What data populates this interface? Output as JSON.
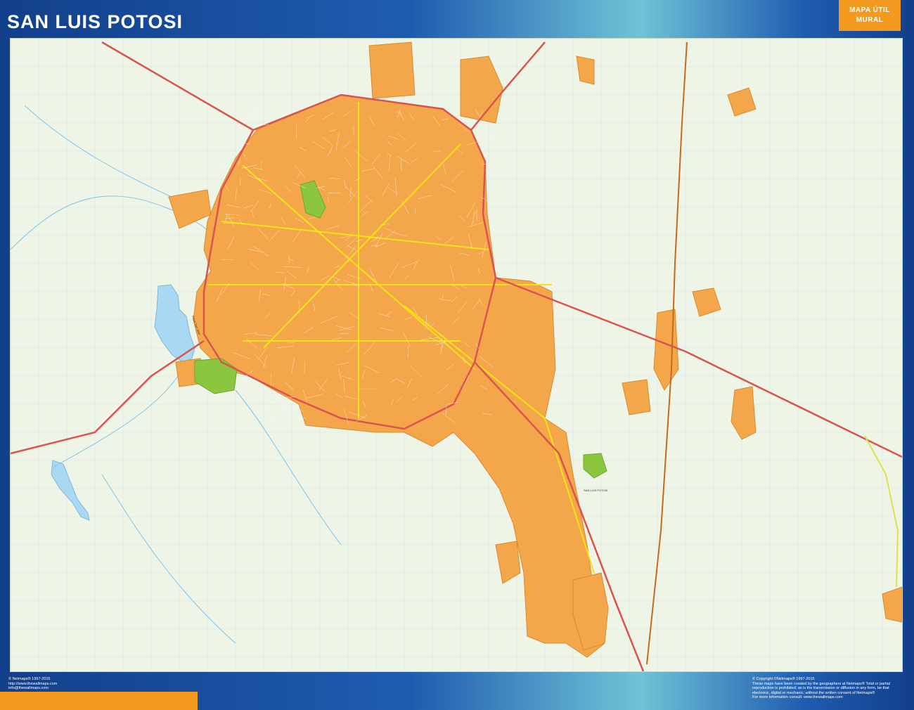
{
  "header": {
    "title": "SAN LUIS POTOSI",
    "badge_line1": "MAPA ÚTIL",
    "badge_line2": "MURAL"
  },
  "map": {
    "labels": {
      "city_center": "SAN LUIS POTOSI",
      "lake": "Presa San José"
    },
    "colors": {
      "land": "#eef5e7",
      "urban": "#f4a74a",
      "park": "#8cc63f",
      "highway": "#d9534f",
      "main_road": "#f2e418",
      "water": "#a9d8f2",
      "rail": "#c46a1e",
      "grid": "#cfdcea"
    }
  },
  "footer": {
    "left_lines": [
      "© Netmaps® 1997-2015",
      "http://www.thewallmaps.com",
      "info@thewallmaps.com"
    ],
    "right_lines": [
      "© Copyright ©Netmaps® 1997-2015",
      "These maps have been created by the geographers at Netmaps® Total or partial",
      "reproduction is prohibited; as is the transmission or diffusion in any form, be that",
      "electronic, digital or mechanic; without the written consent of Netmaps®",
      "For more information consult: www.thewallmaps.com"
    ]
  }
}
